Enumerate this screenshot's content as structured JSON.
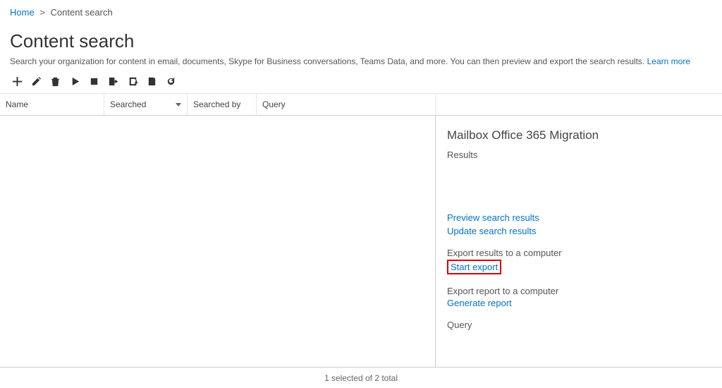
{
  "breadcrumb": {
    "home": "Home",
    "current": "Content search"
  },
  "page": {
    "title": "Content search",
    "description": "Search your organization for content in email, documents, Skype for Business conversations, Teams Data, and more. You can then preview and export the search results.",
    "learn_more": "Learn more"
  },
  "toolbar": {
    "new": "New",
    "edit": "Edit",
    "delete": "Delete",
    "play": "Start",
    "stop": "Stop",
    "export": "Export",
    "download": "Download",
    "report": "Report",
    "refresh": "Refresh"
  },
  "columns": {
    "name": "Name",
    "searched": "Searched",
    "searched_by": "Searched by",
    "query": "Query"
  },
  "detail": {
    "title": "Mailbox Office 365 Migration",
    "results_label": "Results",
    "preview_link": "Preview search results",
    "update_link": "Update search results",
    "export_results_label": "Export results to a computer",
    "start_export_link": "Start export",
    "export_report_label": "Export report to a computer",
    "generate_report_link": "Generate report",
    "query_label": "Query"
  },
  "footer": {
    "selection": "1 selected of 2 total"
  }
}
